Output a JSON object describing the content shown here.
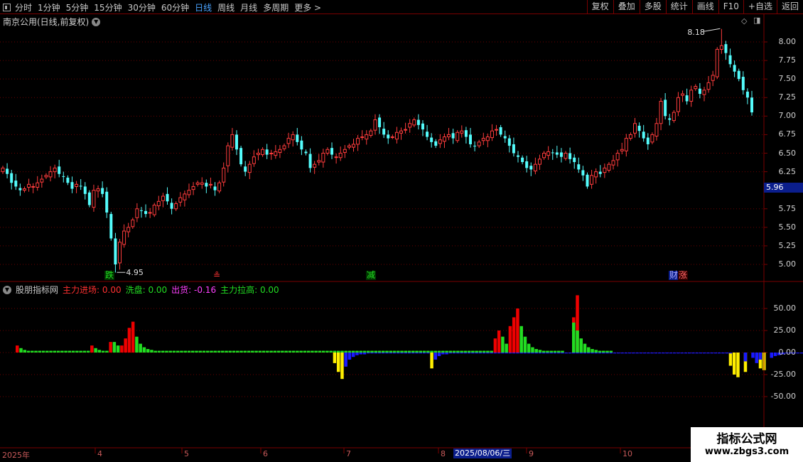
{
  "toolbar": {
    "periods": [
      "分时",
      "1分钟",
      "5分钟",
      "15分钟",
      "30分钟",
      "60分钟",
      "日线",
      "周线",
      "月线",
      "多周期",
      "更多 >"
    ],
    "active_period": "日线",
    "buttons": [
      "复权",
      "叠加",
      "多股",
      "统计",
      "画线",
      "F10",
      "+自选",
      "返回"
    ]
  },
  "price_panel": {
    "title": "南京公用(日线,前复权)",
    "current_price": "5.96",
    "high_label": "8.18",
    "low_label": "4.95",
    "y_ticks": [
      "8.00",
      "7.75",
      "7.50",
      "7.25",
      "7.00",
      "6.75",
      "6.50",
      "6.25",
      "5.75",
      "5.50",
      "5.25",
      "5.00"
    ],
    "events": [
      {
        "text": "跌",
        "color": "#22dd22",
        "bg": "#003300"
      },
      {
        "text": "≗",
        "color": "#ff3333",
        "bg": "#000"
      },
      {
        "text": "减",
        "color": "#22dd22",
        "bg": "#003300"
      },
      {
        "text": "财",
        "color": "#aaaaff",
        "bg": "#0b1e8c"
      },
      {
        "text": "涨",
        "color": "#ff6666",
        "bg": "#330000"
      }
    ]
  },
  "indicator_panel": {
    "name": "股朋指标网",
    "items": [
      {
        "label": "主力进场: 0.00",
        "color": "#ff3030"
      },
      {
        "label": "洗盘: 0.00",
        "color": "#22dd22"
      },
      {
        "label": "出货: -0.16",
        "color": "#ff40ff"
      },
      {
        "label": "主力拉高: 0.00",
        "color": "#22dd22"
      }
    ],
    "y_ticks": [
      "50.00",
      "25.00",
      "0.00",
      "-25.00",
      "-50.00"
    ]
  },
  "date_axis": {
    "labels": [
      "2025年",
      "4",
      "5",
      "6",
      "7",
      "8",
      "9",
      "10"
    ],
    "highlight": "2025/08/06/三"
  },
  "watermark": {
    "line1": "指标公式网",
    "line2": "www.zbgs3.com"
  },
  "chart_data": [
    {
      "type": "candlestick",
      "title": "南京公用(日线,前复权)",
      "ylim": [
        4.85,
        8.3
      ],
      "y_ticks": [
        5.0,
        5.25,
        5.5,
        5.75,
        6.25,
        6.5,
        6.75,
        7.0,
        7.25,
        7.5,
        7.75,
        8.0
      ],
      "annotations": [
        {
          "text": "8.18",
          "value": 8.18
        },
        {
          "text": "4.95",
          "value": 4.95
        }
      ],
      "last": 5.96,
      "closes": [
        6.3,
        6.22,
        6.1,
        6.05,
        6.0,
        6.02,
        6.08,
        6.05,
        6.1,
        6.15,
        6.2,
        6.25,
        6.3,
        6.22,
        6.18,
        6.1,
        6.02,
        6.08,
        6.05,
        5.95,
        5.8,
        6.0,
        6.02,
        5.95,
        5.7,
        5.35,
        5.0,
        5.3,
        5.45,
        5.5,
        5.6,
        5.75,
        5.72,
        5.68,
        5.7,
        5.8,
        5.85,
        5.92,
        5.85,
        5.75,
        5.82,
        5.9,
        5.95,
        6.0,
        6.05,
        6.1,
        6.1,
        6.05,
        6.08,
        6.0,
        6.1,
        6.3,
        6.6,
        6.75,
        6.55,
        6.35,
        6.25,
        6.35,
        6.45,
        6.5,
        6.55,
        6.48,
        6.5,
        6.52,
        6.55,
        6.6,
        6.7,
        6.75,
        6.65,
        6.55,
        6.5,
        6.3,
        6.35,
        6.4,
        6.5,
        6.55,
        6.48,
        6.45,
        6.5,
        6.55,
        6.6,
        6.62,
        6.7,
        6.72,
        6.75,
        6.8,
        6.95,
        6.85,
        6.75,
        6.7,
        6.72,
        6.78,
        6.8,
        6.82,
        6.9,
        6.95,
        6.88,
        6.82,
        6.72,
        6.65,
        6.6,
        6.68,
        6.72,
        6.75,
        6.7,
        6.78,
        6.8,
        6.72,
        6.62,
        6.6,
        6.65,
        6.7,
        6.72,
        6.8,
        6.82,
        6.75,
        6.7,
        6.6,
        6.5,
        6.45,
        6.38,
        6.3,
        6.28,
        6.35,
        6.42,
        6.5,
        6.52,
        6.5,
        6.48,
        6.45,
        6.5,
        6.42,
        6.38,
        6.28,
        6.2,
        6.05,
        6.2,
        6.25,
        6.22,
        6.3,
        6.35,
        6.4,
        6.5,
        6.55,
        6.7,
        6.75,
        6.9,
        6.8,
        6.7,
        6.62,
        6.75,
        6.9,
        7.2,
        7.0,
        6.95,
        7.05,
        7.25,
        7.3,
        7.2,
        7.35,
        7.4,
        7.3,
        7.35,
        7.45,
        7.55,
        7.9,
        7.95,
        7.85,
        7.7,
        7.6,
        7.5,
        7.35,
        7.25,
        7.05
      ]
    },
    {
      "type": "bar",
      "title": "股朋指标网",
      "ylim": [
        -62,
        65
      ],
      "y_ticks": [
        50,
        25,
        0,
        -25,
        -50
      ],
      "series": [
        {
          "name": "主力进场",
          "color": "#ee0000",
          "values": [
            8,
            0,
            0,
            0,
            0,
            0,
            0,
            0,
            0,
            0,
            0,
            0,
            0,
            0,
            0,
            0,
            0,
            0,
            0,
            0,
            8,
            0,
            0,
            0,
            0,
            12,
            0,
            0,
            8,
            16,
            28,
            35,
            0,
            0,
            0,
            0,
            0,
            0,
            0,
            0,
            0,
            0,
            0,
            0,
            0,
            0,
            0,
            0,
            0,
            0,
            0,
            0,
            0,
            0,
            0,
            0,
            0,
            0,
            0,
            0,
            0,
            0,
            0,
            0,
            0,
            0,
            0,
            0,
            0,
            0,
            0,
            0,
            0,
            0,
            0,
            0,
            0,
            0,
            0,
            0,
            0,
            0,
            0,
            0,
            0,
            0,
            0,
            0,
            0,
            0,
            0,
            0,
            0,
            0,
            0,
            0,
            0,
            0,
            0,
            0,
            0,
            0,
            0,
            0,
            0,
            0,
            0,
            0,
            0,
            0,
            0,
            0,
            0,
            0,
            0,
            0,
            0,
            0,
            0,
            0,
            0,
            0,
            0,
            0,
            0,
            0,
            0,
            0,
            16,
            25,
            0,
            0,
            30,
            40,
            50,
            0,
            0,
            0,
            0,
            0,
            0,
            0,
            0,
            0,
            0,
            0,
            0,
            0,
            0,
            40,
            65,
            0,
            0,
            0,
            0,
            0,
            0,
            0,
            0,
            0,
            0,
            0,
            0,
            0,
            0,
            0,
            0,
            0,
            0,
            0,
            0,
            0,
            0,
            0,
            0,
            0,
            0,
            0,
            0,
            0,
            0,
            0,
            0,
            0,
            0,
            0,
            0,
            0,
            0,
            0,
            0,
            0,
            0,
            0,
            0,
            0,
            0
          ]
        },
        {
          "name": "洗盘",
          "color": "#22dd22",
          "values": [
            0,
            5,
            3,
            2,
            2,
            2,
            2,
            2,
            2,
            2,
            2,
            2,
            2,
            2,
            2,
            2,
            2,
            2,
            2,
            2,
            0,
            5,
            3,
            2,
            2,
            0,
            12,
            8,
            0,
            0,
            0,
            0,
            18,
            10,
            6,
            4,
            3,
            2,
            2,
            2,
            2,
            2,
            2,
            2,
            2,
            2,
            2,
            2,
            2,
            2,
            2,
            2,
            2,
            2,
            2,
            2,
            2,
            2,
            2,
            2,
            2,
            2,
            2,
            2,
            2,
            2,
            2,
            2,
            2,
            2,
            2,
            2,
            2,
            2,
            2,
            2,
            2,
            2,
            2,
            2,
            2,
            2,
            2,
            2,
            2,
            2,
            2,
            2,
            2,
            2,
            2,
            2,
            2,
            2,
            2,
            2,
            2,
            2,
            2,
            2,
            2,
            2,
            2,
            2,
            2,
            2,
            2,
            2,
            2,
            2,
            2,
            2,
            2,
            2,
            2,
            2,
            2,
            2,
            2,
            2,
            2,
            2,
            2,
            2,
            2,
            2,
            2,
            2,
            0,
            0,
            18,
            10,
            0,
            0,
            0,
            30,
            18,
            10,
            6,
            4,
            3,
            2,
            2,
            2,
            2,
            2,
            2,
            0,
            0,
            34,
            25,
            16,
            10,
            6,
            4,
            3,
            2,
            2,
            2,
            2,
            0,
            0,
            0,
            0,
            0,
            0,
            0,
            0,
            0,
            0,
            0,
            0,
            0,
            0,
            0,
            0,
            0,
            0,
            0,
            0,
            0,
            0,
            0,
            0,
            0,
            0,
            0,
            0,
            0,
            0,
            0,
            0,
            0,
            0,
            0,
            0,
            0,
            0
          ]
        },
        {
          "name": "出货",
          "color": "#ffee00",
          "values": [
            0,
            0,
            0,
            0,
            0,
            0,
            0,
            0,
            0,
            0,
            0,
            0,
            0,
            0,
            0,
            0,
            0,
            0,
            0,
            0,
            0,
            0,
            0,
            0,
            0,
            0,
            0,
            0,
            0,
            0,
            0,
            0,
            0,
            0,
            0,
            0,
            0,
            0,
            0,
            0,
            0,
            0,
            0,
            0,
            0,
            0,
            0,
            0,
            0,
            0,
            0,
            0,
            0,
            0,
            0,
            0,
            0,
            0,
            0,
            0,
            0,
            0,
            0,
            0,
            0,
            0,
            0,
            0,
            0,
            0,
            0,
            0,
            0,
            0,
            0,
            0,
            0,
            0,
            0,
            0,
            0,
            0,
            0,
            0,
            0,
            -12,
            -22,
            -30,
            0,
            0,
            0,
            0,
            0,
            0,
            0,
            0,
            0,
            0,
            0,
            0,
            0,
            0,
            0,
            0,
            0,
            0,
            0,
            0,
            0,
            0,
            0,
            -18,
            0,
            0,
            0,
            0,
            0,
            0,
            0,
            0,
            0,
            0,
            0,
            0,
            0,
            0,
            0,
            0,
            0,
            0,
            0,
            0,
            0,
            0,
            0,
            0,
            0,
            0,
            0,
            0,
            0,
            0,
            0,
            0,
            0,
            0,
            0,
            0,
            0,
            0,
            0,
            0,
            0,
            0,
            0,
            0,
            0,
            0,
            0,
            0,
            0,
            0,
            0,
            0,
            0,
            0,
            0,
            0,
            0,
            0,
            0,
            0,
            0,
            0,
            0,
            0,
            0,
            0,
            0,
            0,
            0,
            0,
            0,
            0,
            0,
            0,
            0,
            0,
            0,
            0,
            0,
            -15,
            -25,
            -28,
            0,
            -22,
            0,
            0,
            0,
            -18,
            -20,
            0,
            0,
            0,
            0,
            0,
            0,
            0,
            0,
            0,
            0,
            0,
            0,
            0,
            0,
            0,
            0,
            0,
            0
          ]
        },
        {
          "name": "主力拉高",
          "color": "#1a1aff",
          "values": [
            0,
            0,
            0,
            0,
            0,
            0,
            0,
            0,
            0,
            0,
            0,
            0,
            0,
            0,
            0,
            0,
            0,
            0,
            0,
            0,
            0,
            0,
            0,
            0,
            0,
            0,
            0,
            0,
            0,
            0,
            0,
            0,
            0,
            0,
            0,
            0,
            0,
            0,
            0,
            0,
            0,
            0,
            0,
            0,
            0,
            0,
            0,
            0,
            0,
            0,
            0,
            0,
            0,
            0,
            0,
            0,
            0,
            0,
            0,
            0,
            0,
            0,
            0,
            0,
            0,
            0,
            0,
            0,
            0,
            0,
            0,
            0,
            0,
            0,
            0,
            0,
            0,
            0,
            0,
            0,
            0,
            0,
            0,
            0,
            0,
            0,
            0,
            0,
            -16,
            -8,
            -5,
            -3,
            -2,
            -2,
            -1,
            -1,
            -1,
            -1,
            -1,
            -1,
            -1,
            -1,
            -1,
            -1,
            -1,
            -1,
            -1,
            -1,
            -1,
            -1,
            -1,
            0,
            -8,
            -4,
            -2,
            -2,
            -1,
            -1,
            -1,
            -1,
            -1,
            -1,
            -1,
            -1,
            -1,
            -1,
            -1,
            -1,
            -1,
            -1,
            -1,
            -1,
            -1,
            -1,
            -1,
            -1,
            -1,
            -1,
            -1,
            -1,
            -1,
            -1,
            -1,
            -1,
            -1,
            -1,
            -1,
            -1,
            -1,
            -1,
            -1,
            -1,
            -1,
            -1,
            -1,
            -1,
            -1,
            -1,
            -1,
            -1,
            -1,
            -1,
            -1,
            -1,
            -1,
            -1,
            -1,
            -1,
            -1,
            -1,
            -1,
            -1,
            -1,
            -1,
            -1,
            -1,
            -1,
            -1,
            -1,
            -1,
            -1,
            -1,
            -1,
            -1,
            -1,
            -1,
            -1,
            -1,
            -1,
            -1,
            -1,
            -1,
            0,
            0,
            0,
            -10,
            0,
            -6,
            -12,
            -8,
            0,
            0,
            -6,
            -4,
            -3,
            -2,
            -1,
            -1,
            -1,
            -1,
            -1,
            -1,
            -1,
            -1,
            -1,
            -1,
            -1,
            -1,
            -1,
            -1
          ]
        }
      ]
    }
  ]
}
